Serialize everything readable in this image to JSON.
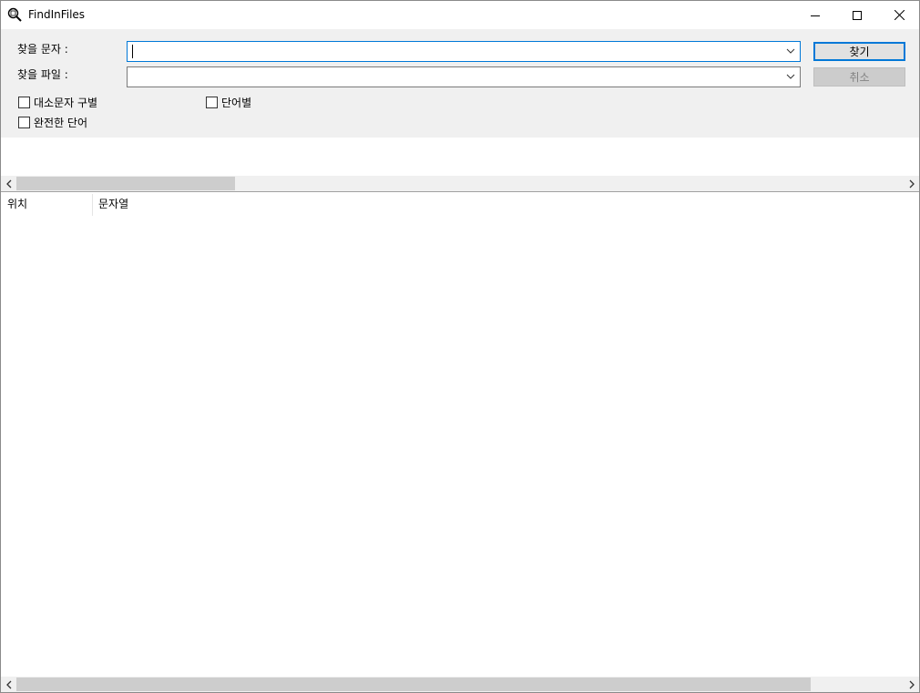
{
  "window": {
    "title": "FindInFiles",
    "icon": "magnifier-icon"
  },
  "titlebar": {
    "minimize_icon": "minimize-icon",
    "maximize_icon": "maximize-icon",
    "close_icon": "close-icon"
  },
  "form": {
    "find_text_label": "찾을 문자 :",
    "find_text_value": "",
    "find_files_label": "찾을 파일 :",
    "find_files_value": "",
    "find_button": "찾기",
    "cancel_button": "취소"
  },
  "options": {
    "match_case": {
      "label": "대소문자 구별",
      "checked": false
    },
    "word_by_word": {
      "label": "단어별",
      "checked": false
    },
    "whole_word": {
      "label": "완전한 단어",
      "checked": false
    }
  },
  "results": {
    "columns": [
      "위치",
      "문자열"
    ],
    "rows": []
  },
  "colors": {
    "accent": "#0078d7",
    "panel": "#f0f0f0",
    "scroll_thumb": "#cdcdcd"
  }
}
